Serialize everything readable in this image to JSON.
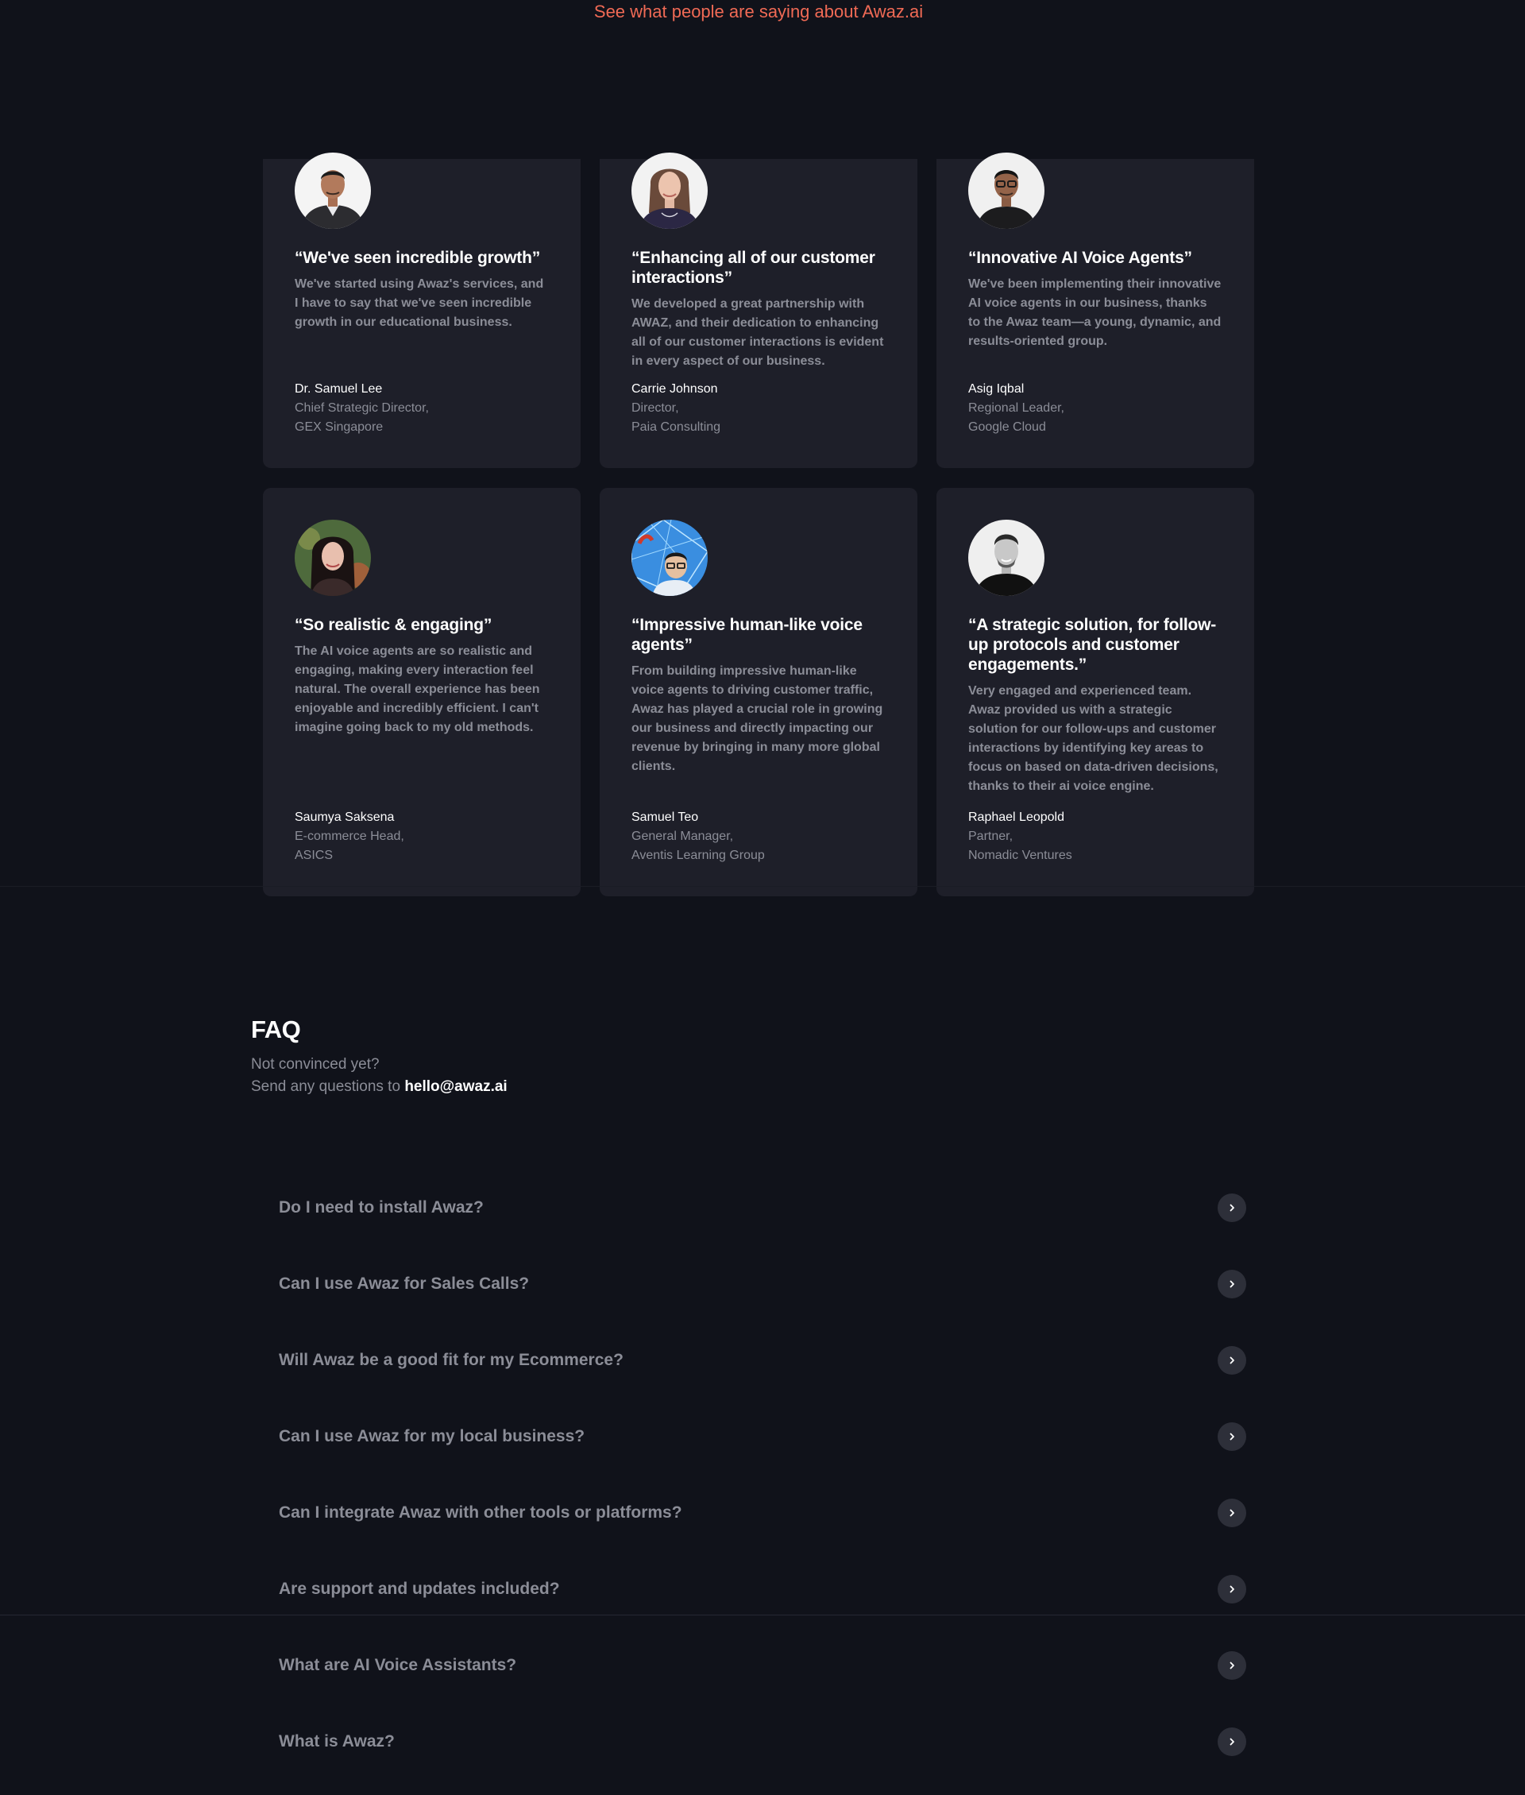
{
  "header": {
    "subtitle": "See what people are saying about Awaz.ai"
  },
  "testimonials": [
    {
      "title": "“We've seen incredible growth”",
      "quote": "We've started using Awaz's services, and I have to say that we've seen incredible growth in our educational business.",
      "name": "Dr. Samuel Lee",
      "role": "Chief Strategic Director,",
      "org": "GEX Singapore"
    },
    {
      "title": "“Enhancing all of our customer interactions”",
      "quote": "We developed a great partnership with AWAZ, and their dedication to enhancing all of our customer interactions is evident in every aspect of our business.",
      "name": "Carrie Johnson",
      "role": "Director,",
      "org": "Paia Consulting"
    },
    {
      "title": "“Innovative AI Voice Agents”",
      "quote": "We've been implementing their innovative AI voice agents in our business, thanks to the Awaz team—a young, dynamic, and results-oriented group.",
      "name": "Asig Iqbal",
      "role": "Regional Leader,",
      "org": "Google Cloud"
    },
    {
      "title": "“So realistic & engaging”",
      "quote": "The AI voice agents are so realistic and engaging, making every interaction feel natural. The overall experience has been enjoyable and incredibly efficient. I can't imagine going back to my old methods.",
      "name": "Saumya Saksena",
      "role": "E-commerce Head,",
      "org": "ASICS"
    },
    {
      "title": "“Impressive human-like voice agents”",
      "quote": "From building impressive human-like voice agents to driving customer traffic, Awaz has played a crucial role in growing our business and directly impacting our revenue by bringing in many more global clients.",
      "name": "Samuel Teo",
      "role": "General Manager,",
      "org": "Aventis Learning Group"
    },
    {
      "title": "“A strategic solution, for follow-up protocols and customer engagements.”",
      "quote": "Very engaged and experienced team. Awaz provided us with a strategic solution for our follow-ups and customer interactions by identifying key areas to focus on based on data-driven decisions, thanks to their ai voice engine.",
      "name": "Raphael Leopold",
      "role": "Partner,",
      "org": "Nomadic Ventures"
    }
  ],
  "faq": {
    "title": "FAQ",
    "line1": "Not convinced yet?",
    "line2_prefix": "Send any questions to ",
    "email": "hello@awaz.ai",
    "button_icon": "chevron-right-icon",
    "items": [
      "Do I need to install Awaz?",
      "Can I use Awaz for Sales Calls?",
      "Will Awaz be a good fit for my Ecommerce?",
      "Can I use Awaz for my local business?",
      "Can I integrate Awaz with other tools or platforms?",
      "Are support and updates included?",
      "What are AI Voice Assistants?",
      "What is Awaz?"
    ]
  },
  "colors": {
    "background": "#10121a",
    "card": "#1e1f29",
    "accent": "#f06a55",
    "muted_text": "#8b8d97"
  }
}
